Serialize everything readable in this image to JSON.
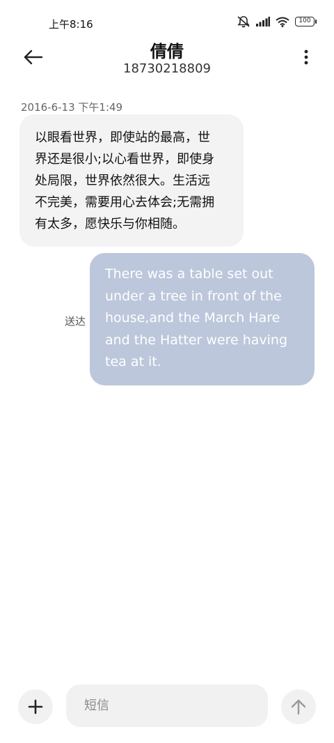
{
  "status_bar": {
    "time": "上午8:16",
    "icons": [
      "mute-icon",
      "signal-icon",
      "wifi-icon",
      "battery-icon"
    ],
    "battery_level": "100"
  },
  "header": {
    "contact_name": "倩倩",
    "contact_number": "18730218809",
    "back_icon": "back-arrow-icon",
    "more_icon": "more-vertical-icon"
  },
  "messages": [
    {
      "direction": "incoming",
      "timestamp": "2016-6-13 下午1:49",
      "lines": [
        "以眼看世界，即使站的最高，世",
        "界还是很小;以心看世界，即使身",
        "处局限，世界依然很大。生活远",
        "不完美，需要用心去体会;无需拥",
        "有太多，愿快乐与你相随。"
      ]
    },
    {
      "direction": "outgoing",
      "status": "送达",
      "lines": [
        "There was a table set out",
        "under a tree in front of the",
        "house,and the March Hare",
        "and the Hatter were having",
        "tea at it."
      ]
    }
  ],
  "composer": {
    "add_icon": "plus-icon",
    "placeholder": "短信",
    "value": "",
    "send_icon": "send-arrow-up-icon"
  },
  "colors": {
    "incoming_bubble": "#f3f3f3",
    "outgoing_bubble": "#bcc7db",
    "input_background": "#f1f1f1"
  }
}
